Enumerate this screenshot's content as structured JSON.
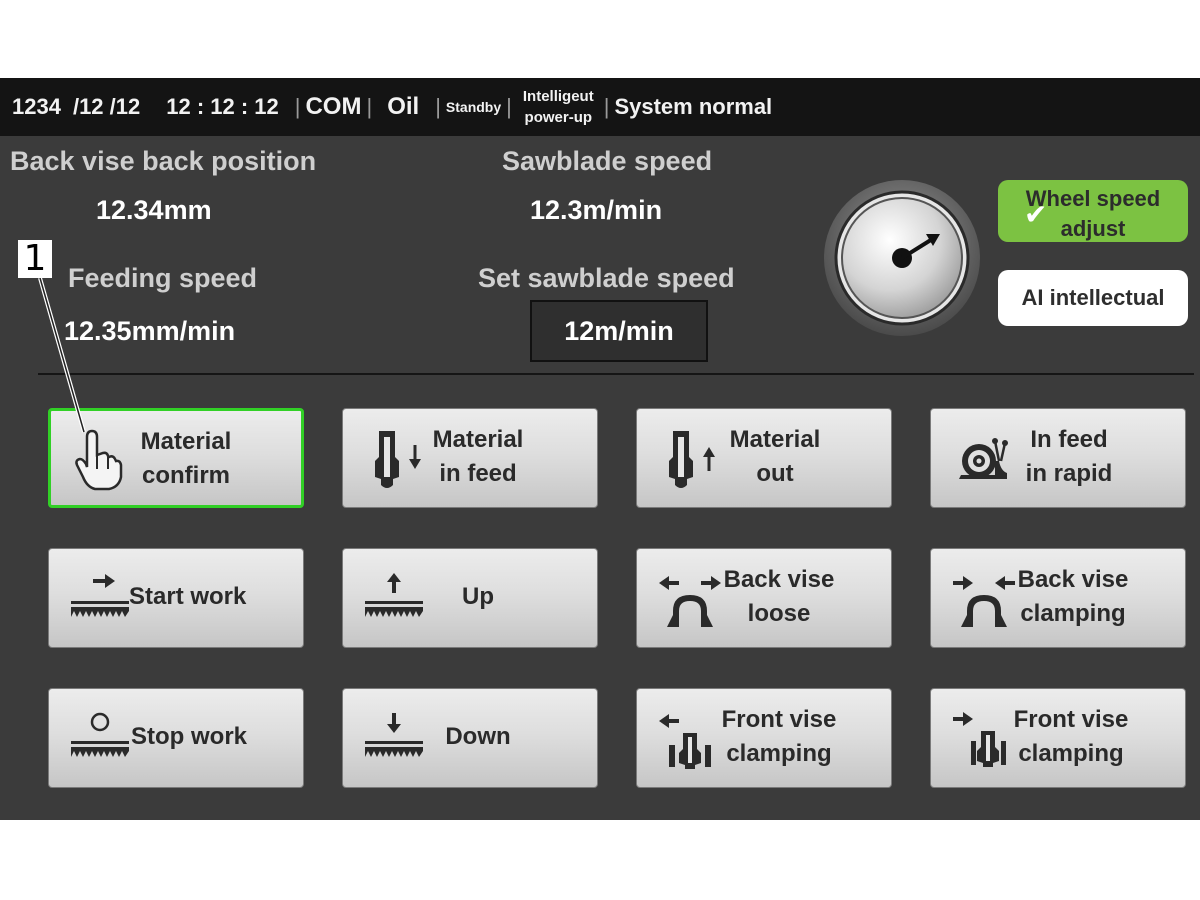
{
  "statusbar": {
    "date_year": "1234",
    "date_rest": "/12 /12",
    "time": "12 : 12 : 12",
    "com": "COM",
    "oil": "Oil",
    "standby": "Standby",
    "power_line1": "Intelligeut",
    "power_line2": "power-up",
    "system_status": "System normal"
  },
  "readouts": {
    "back_vise_label": "Back vise back position",
    "back_vise_value": "12.34mm",
    "sawblade_speed_label": "Sawblade speed",
    "sawblade_speed_value": "12.3m/min",
    "feeding_speed_label": "Feeding speed",
    "feeding_speed_value": "12.35mm/min",
    "set_sawblade_label": "Set sawblade speed",
    "set_sawblade_value": "12m/min"
  },
  "right_panel": {
    "wheel_speed_line1": "Wheel speed",
    "wheel_speed_line2": "adjust",
    "ai_label": "AI intellectual"
  },
  "callout": {
    "number": "1"
  },
  "buttons": [
    {
      "l1": "Material",
      "l2": "confirm",
      "icon": "hand-pointer-icon"
    },
    {
      "l1": "Material",
      "l2": "in feed",
      "icon": "material-in-feed-icon"
    },
    {
      "l1": "Material",
      "l2": "out",
      "icon": "material-out-icon"
    },
    {
      "l1": "In feed",
      "l2": "in rapid",
      "icon": "snail-icon"
    },
    {
      "l1": "Start work",
      "l2": "",
      "icon": "start-work-icon"
    },
    {
      "l1": "Up",
      "l2": "",
      "icon": "saw-up-icon"
    },
    {
      "l1": "Back vise",
      "l2": "loose",
      "icon": "back-vise-loose-icon"
    },
    {
      "l1": "Back vise",
      "l2": "clamping",
      "icon": "back-vise-clamp-icon"
    },
    {
      "l1": "Stop work",
      "l2": "",
      "icon": "stop-work-icon"
    },
    {
      "l1": "Down",
      "l2": "",
      "icon": "saw-down-icon"
    },
    {
      "l1": "Front vise",
      "l2": "clamping",
      "icon": "front-vise-open-icon"
    },
    {
      "l1": "Front vise",
      "l2": "clamping",
      "icon": "front-vise-clamp-icon"
    }
  ],
  "colors": {
    "screen_bg": "#3b3b3b",
    "statusbar_bg": "#141414",
    "accent_green": "#7cc242",
    "selected_border": "#31d026"
  }
}
